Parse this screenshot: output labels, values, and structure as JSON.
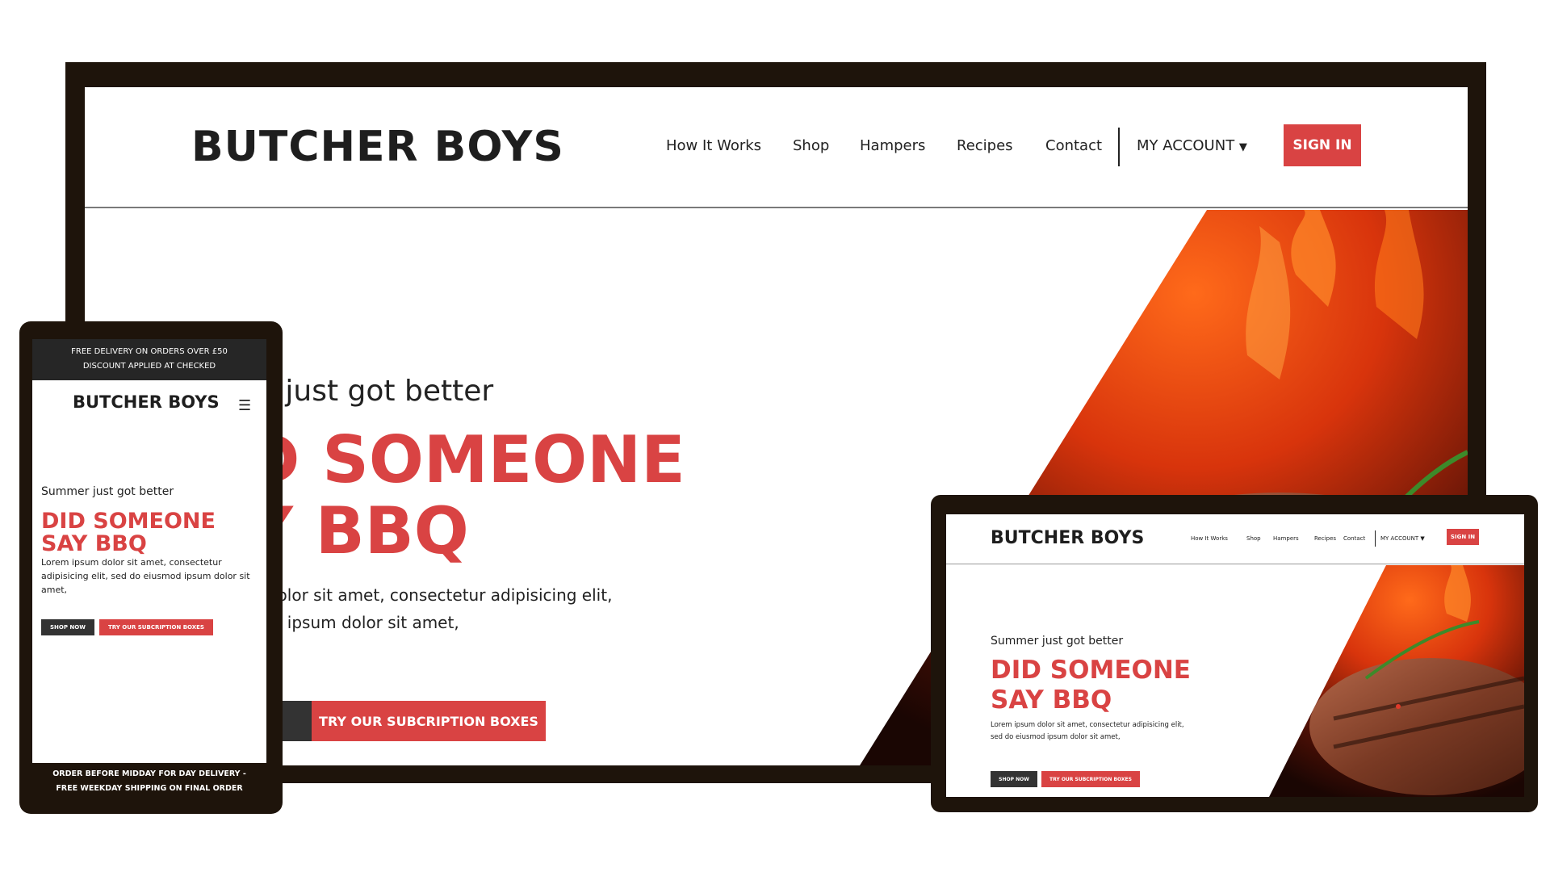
{
  "brand": {
    "name": "BUTCHER BOYS",
    "accent": "#d94343",
    "dark": "#333333",
    "frame": "#1e140b"
  },
  "nav": {
    "items": [
      "How It Works",
      "Shop",
      "Hampers",
      "Recipes",
      "Contact"
    ],
    "account": "MY ACCOUNT",
    "sign_in": "SIGN IN"
  },
  "hero": {
    "subtitle": "Summer just got better",
    "headline_1": "DID SOMEONE",
    "headline_2": "SAY BBQ",
    "body": "Lorem ipsum dolor sit amet, consectetur adipisicing elit, sed do eiusmod ipsum dolor sit amet,",
    "shop_button": "SHOP NOW",
    "try_button": "TRY OUR SUBCRIPTION BOXES",
    "image": "grilled-steak-flames"
  },
  "desktop_partial": {
    "subtitle": "er just got better",
    "headline_1": "D SOMEONE",
    "headline_2": "Y BBQ",
    "body_1": "m dolor sit amet, consectetur adipisicing elit,",
    "body_2": "mod ipsum dolor sit amet,"
  },
  "mobile": {
    "top_line_1": "FREE DELIVERY ON ORDERS OVER £50",
    "top_line_2": "DISCOUNT APPLIED AT CHECKED",
    "menu_icon": "hamburger-icon",
    "bottom_line_1": "ORDER BEFORE MIDDAY FOR DAY DELIVERY -",
    "bottom_line_2": "FREE WEEKDAY SHIPPING ON FINAL ORDER"
  }
}
